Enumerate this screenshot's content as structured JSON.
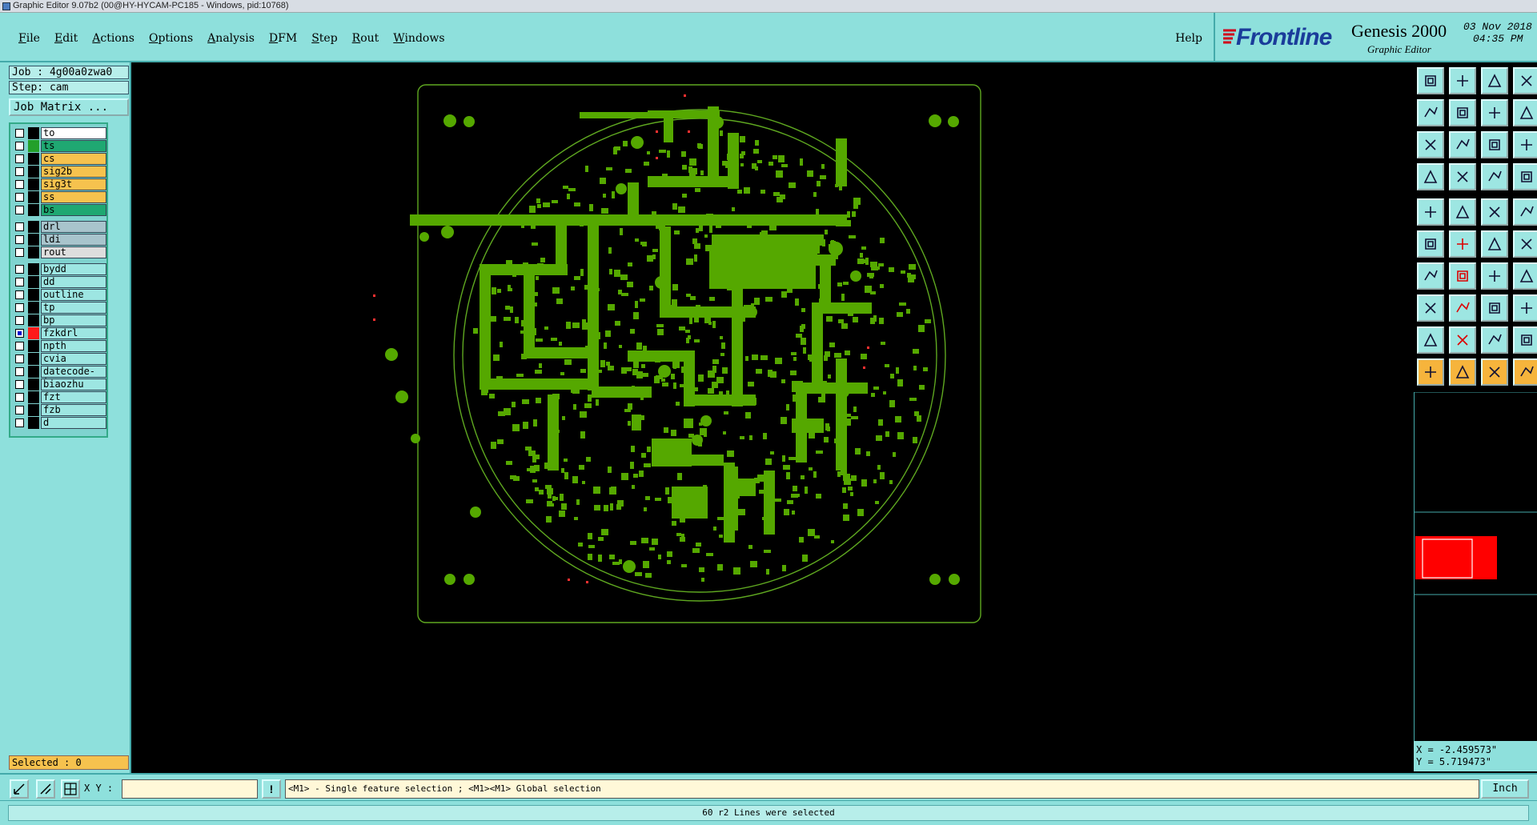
{
  "window": {
    "title": "Graphic Editor 9.07b2 (00@HY-HYCAM-PC185 - Windows, pid:10768)"
  },
  "menu": {
    "items": [
      "File",
      "Edit",
      "Actions",
      "Options",
      "Analysis",
      "DFM",
      "Step",
      "Rout",
      "Windows"
    ],
    "help": "Help"
  },
  "brand": {
    "logo": "Frontline",
    "product": "Genesis 2000",
    "subtitle": "Graphic Editor",
    "date": "03 Nov 2018",
    "time": "04:35 PM"
  },
  "job": {
    "job_label": "Job : 4g00a0zwa0",
    "step_label": "Step: cam",
    "matrix_button": "Job Matrix ..."
  },
  "layers": [
    {
      "name": "to",
      "color": "#ffffff",
      "swatch": "#000000",
      "checked": false
    },
    {
      "name": "ts",
      "color": "#1fa872",
      "swatch": "#23a02a",
      "checked": false
    },
    {
      "name": "cs",
      "color": "#f6c24e",
      "swatch": "#000000",
      "checked": false
    },
    {
      "name": "sig2b",
      "color": "#f6c24e",
      "swatch": "#000000",
      "checked": false
    },
    {
      "name": "sig3t",
      "color": "#f6c24e",
      "swatch": "#000000",
      "checked": false
    },
    {
      "name": "ss",
      "color": "#f6c24e",
      "swatch": "#000000",
      "checked": false
    },
    {
      "name": "bs",
      "color": "#1fa872",
      "swatch": "#000000",
      "checked": false
    },
    {
      "name": "drl",
      "color": "#a8c4cc",
      "swatch": "#000000",
      "checked": false
    },
    {
      "name": "ldi",
      "color": "#a8c4cc",
      "swatch": "#000000",
      "checked": false
    },
    {
      "name": "rout",
      "color": "#dddddd",
      "swatch": "#000000",
      "checked": false
    },
    {
      "name": "bydd",
      "color": "#9de6e2",
      "swatch": "#000000",
      "checked": false
    },
    {
      "name": "dd",
      "color": "#9de6e2",
      "swatch": "#000000",
      "checked": false
    },
    {
      "name": "outline",
      "color": "#9de6e2",
      "swatch": "#000000",
      "checked": false
    },
    {
      "name": "tp",
      "color": "#9de6e2",
      "swatch": "#000000",
      "checked": false
    },
    {
      "name": "bp",
      "color": "#9de6e2",
      "swatch": "#000000",
      "checked": false
    },
    {
      "name": "fzkdrl",
      "color": "#9de6e2",
      "swatch": "#ff1a1a",
      "checked": true
    },
    {
      "name": "npth",
      "color": "#9de6e2",
      "swatch": "#000000",
      "checked": false
    },
    {
      "name": "cvia",
      "color": "#9de6e2",
      "swatch": "#000000",
      "checked": false
    },
    {
      "name": "datecode-to",
      "color": "#9de6e2",
      "swatch": "#000000",
      "checked": false
    },
    {
      "name": "biaozhu",
      "color": "#9de6e2",
      "swatch": "#000000",
      "checked": false
    },
    {
      "name": "fzt",
      "color": "#9de6e2",
      "swatch": "#000000",
      "checked": false
    },
    {
      "name": "fzb",
      "color": "#9de6e2",
      "swatch": "#000000",
      "checked": false
    },
    {
      "name": "d",
      "color": "#9de6e2",
      "swatch": "#000000",
      "checked": false
    }
  ],
  "selection": {
    "count_label": "Selected : 0"
  },
  "coords": {
    "x": "X = -2.459573\"",
    "y": "Y = 5.719473\""
  },
  "command": {
    "xy_label": "X Y :",
    "xy_value": "",
    "hint": "<M1> - Single feature selection ; <M1><M1> Global selection",
    "units": "Inch"
  },
  "status": {
    "message": "60 r2 Lines were selected"
  },
  "colors": {
    "panel": "#8ee0dc",
    "copper": "#55a800",
    "outline": "#5fa820",
    "accent_red": "#ff0000"
  }
}
